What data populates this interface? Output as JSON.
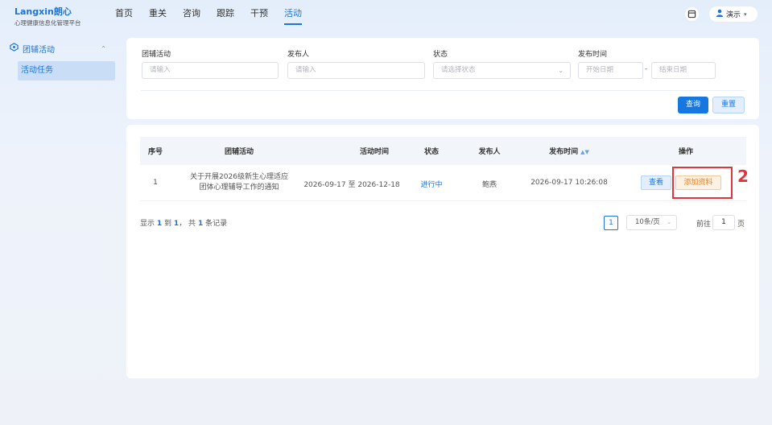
{
  "header": {
    "logo_brand": "Langxin",
    "logo_brand_cn": "朗心",
    "logo_sub": "心理健康信息化管理平台",
    "nav": [
      "首页",
      "重关",
      "咨询",
      "跟踪",
      "干预",
      "活动"
    ],
    "active_nav": "活动",
    "user_name": "演示",
    "icons": [
      "calendar-icon",
      "user-icon",
      "chevron-down-icon"
    ]
  },
  "sidebar": {
    "group_label": "团辅活动",
    "items": [
      {
        "label": "活动任务"
      }
    ]
  },
  "filters": {
    "activity_label": "团辅活动",
    "activity_placeholder": "请输入",
    "publisher_label": "发布人",
    "publisher_placeholder": "请输入",
    "status_label": "状态",
    "status_placeholder": "请选择状态",
    "time_label": "发布时间",
    "start_placeholder": "开始日期",
    "separator": "-",
    "end_placeholder": "结束日期",
    "query_button": "查询",
    "reset_button": "重置"
  },
  "table": {
    "columns": [
      "序号",
      "团辅活动",
      "活动时间",
      "状态",
      "发布人",
      "发布时间",
      "操作"
    ],
    "rows": [
      {
        "index": "1",
        "activity_line1": "关于开展2026级新生心理适应",
        "activity_line2": "团体心理辅导工作的通知",
        "activity_time": "2026-09-17 至 2026-12-18",
        "status": "进行中",
        "publisher": "鲍燕",
        "publish_time": "2026-09-17 10:26:08",
        "view_button": "查看",
        "add_button": "添加资料"
      }
    ]
  },
  "annotation": {
    "label": "2",
    "color": "#e0353c"
  },
  "pagination": {
    "prefix": "显示",
    "from": "1",
    "to_word": "到",
    "to": "1",
    "total_prefix": "，  共",
    "total": "1",
    "suffix": "条记录",
    "current_page": "1",
    "page_size": "10条/页",
    "goto_label": "前往",
    "goto_value": "1",
    "page_label": "页"
  },
  "colors": {
    "accent": "#1e74d8",
    "warning": "#e8852b",
    "annotation": "#e0353c"
  }
}
